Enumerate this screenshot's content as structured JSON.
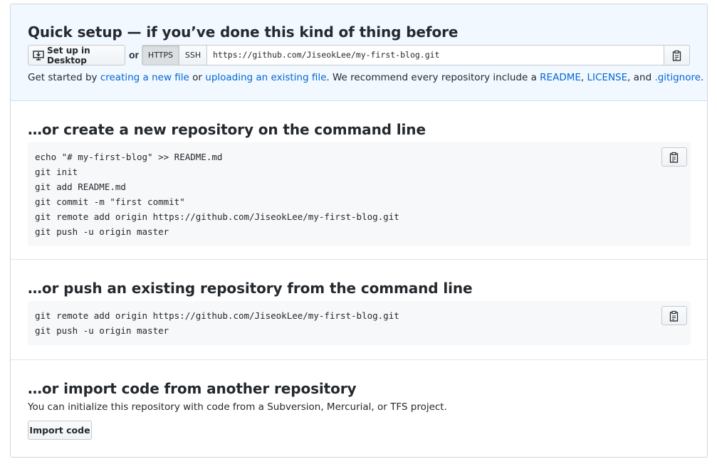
{
  "quick_setup": {
    "title": "Quick setup — if you’ve done this kind of thing before",
    "desktop_button": "Set up in Desktop",
    "or_label": "or",
    "protocols": {
      "https": "HTTPS",
      "ssh": "SSH",
      "selected": "HTTPS"
    },
    "clone_url": "https://github.com/JiseokLee/my-first-blog.git",
    "help": {
      "prefix": "Get started by ",
      "link_new_file": "creating a new file",
      "or": " or ",
      "link_upload": "uploading an existing file",
      "middle": ". We recommend every repository include a ",
      "link_readme": "README",
      "comma": ", ",
      "link_license": "LICENSE",
      "and": ", and ",
      "link_gitignore": ".gitignore",
      "end": "."
    }
  },
  "new_repo": {
    "title": "…or create a new repository on the command line",
    "lines": [
      "echo \"# my-first-blog\" >> README.md",
      "git init",
      "git add README.md",
      "git commit -m \"first commit\"",
      "git remote add origin https://github.com/JiseokLee/my-first-blog.git",
      "git push -u origin master"
    ]
  },
  "push_repo": {
    "title": "…or push an existing repository from the command line",
    "lines": [
      "git remote add origin https://github.com/JiseokLee/my-first-blog.git",
      "git push -u origin master"
    ]
  },
  "import_repo": {
    "title": "…or import code from another repository",
    "description": "You can initialize this repository with code from a Subversion, Mercurial, or TFS project.",
    "button": "Import code"
  },
  "colors": {
    "link": "#0366d6",
    "quick_bg": "#f1f8ff",
    "code_bg": "#f6f8fa"
  }
}
